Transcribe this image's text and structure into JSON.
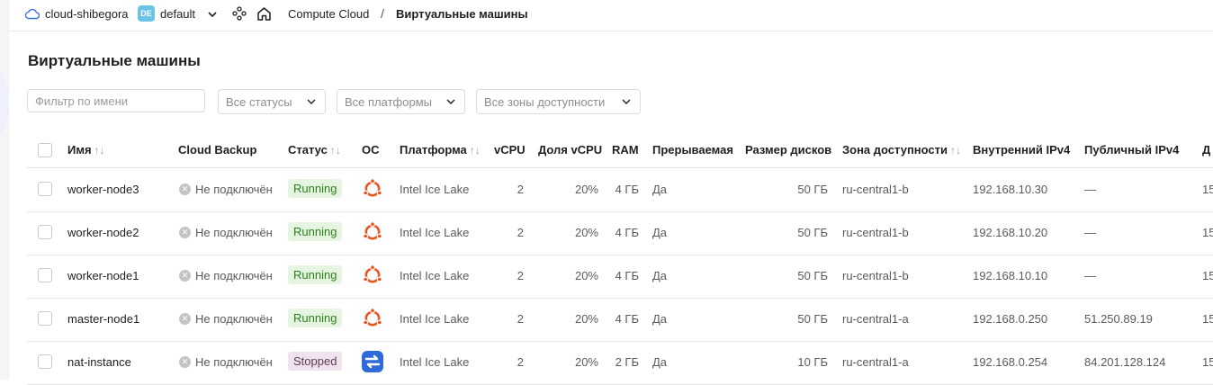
{
  "topbar": {
    "cloud_name": "cloud-shibegora",
    "folder_badge": "DE",
    "folder_name": "default",
    "breadcrumb": [
      "Compute Cloud",
      "/",
      "Виртуальные машины"
    ]
  },
  "page": {
    "title": "Виртуальные машины"
  },
  "filters": {
    "name_placeholder": "Фильтр по имени",
    "status_select": "Все статусы",
    "platform_select": "Все платформы",
    "zone_select": "Все зоны доступности"
  },
  "columns": {
    "name": "Имя",
    "backup": "Cloud Backup",
    "status": "Статус",
    "os": "ОС",
    "platform": "Платформа",
    "vcpu": "vCPU",
    "vcpu_share": "Доля vCPU",
    "ram": "RAM",
    "preemptible": "Прерываемая",
    "disk": "Размер дисков",
    "zone": "Зона доступности",
    "ipv4_internal": "Внутренний IPv4",
    "ipv4_public": "Публичный IPv4",
    "cut": "Д",
    "sort_glyph": "↑↓"
  },
  "rows": [
    {
      "name": "worker-node3",
      "backup": "Не подключён",
      "status": "Running",
      "os": "ubuntu-icon",
      "platform": "Intel Ice Lake",
      "vcpu": "2",
      "share": "20%",
      "ram": "4 ГБ",
      "preemptible": "Да",
      "disk": "50 ГБ",
      "zone": "ru-central1-b",
      "ip_int": "192.168.10.30",
      "ip_pub": "—",
      "cut": "15"
    },
    {
      "name": "worker-node2",
      "backup": "Не подключён",
      "status": "Running",
      "os": "ubuntu-icon",
      "platform": "Intel Ice Lake",
      "vcpu": "2",
      "share": "20%",
      "ram": "4 ГБ",
      "preemptible": "Да",
      "disk": "50 ГБ",
      "zone": "ru-central1-b",
      "ip_int": "192.168.10.20",
      "ip_pub": "—",
      "cut": "15"
    },
    {
      "name": "worker-node1",
      "backup": "Не подключён",
      "status": "Running",
      "os": "ubuntu-icon",
      "platform": "Intel Ice Lake",
      "vcpu": "2",
      "share": "20%",
      "ram": "4 ГБ",
      "preemptible": "Да",
      "disk": "50 ГБ",
      "zone": "ru-central1-b",
      "ip_int": "192.168.10.10",
      "ip_pub": "—",
      "cut": "15"
    },
    {
      "name": "master-node1",
      "backup": "Не подключён",
      "status": "Running",
      "os": "ubuntu-icon",
      "platform": "Intel Ice Lake",
      "vcpu": "2",
      "share": "20%",
      "ram": "4 ГБ",
      "preemptible": "Да",
      "disk": "50 ГБ",
      "zone": "ru-central1-a",
      "ip_int": "192.168.0.250",
      "ip_pub": "51.250.89.19",
      "cut": "15"
    },
    {
      "name": "nat-instance",
      "backup": "Не подключён",
      "status": "Stopped",
      "os": "nat-instance-icon",
      "platform": "Intel Ice Lake",
      "vcpu": "2",
      "share": "20%",
      "ram": "2 ГБ",
      "preemptible": "Да",
      "disk": "10 ГБ",
      "zone": "ru-central1-a",
      "ip_int": "192.168.0.254",
      "ip_pub": "84.201.128.124",
      "cut": "15"
    }
  ],
  "colors": {
    "running_bg": "#e5f5df",
    "running_fg": "#2f7d22",
    "stopped_bg": "#f0e3ee",
    "stopped_fg": "#5c3b59",
    "ubuntu": "#e95420",
    "nat": "#2f6bd8",
    "folder_badge": "#6bc3e8"
  }
}
